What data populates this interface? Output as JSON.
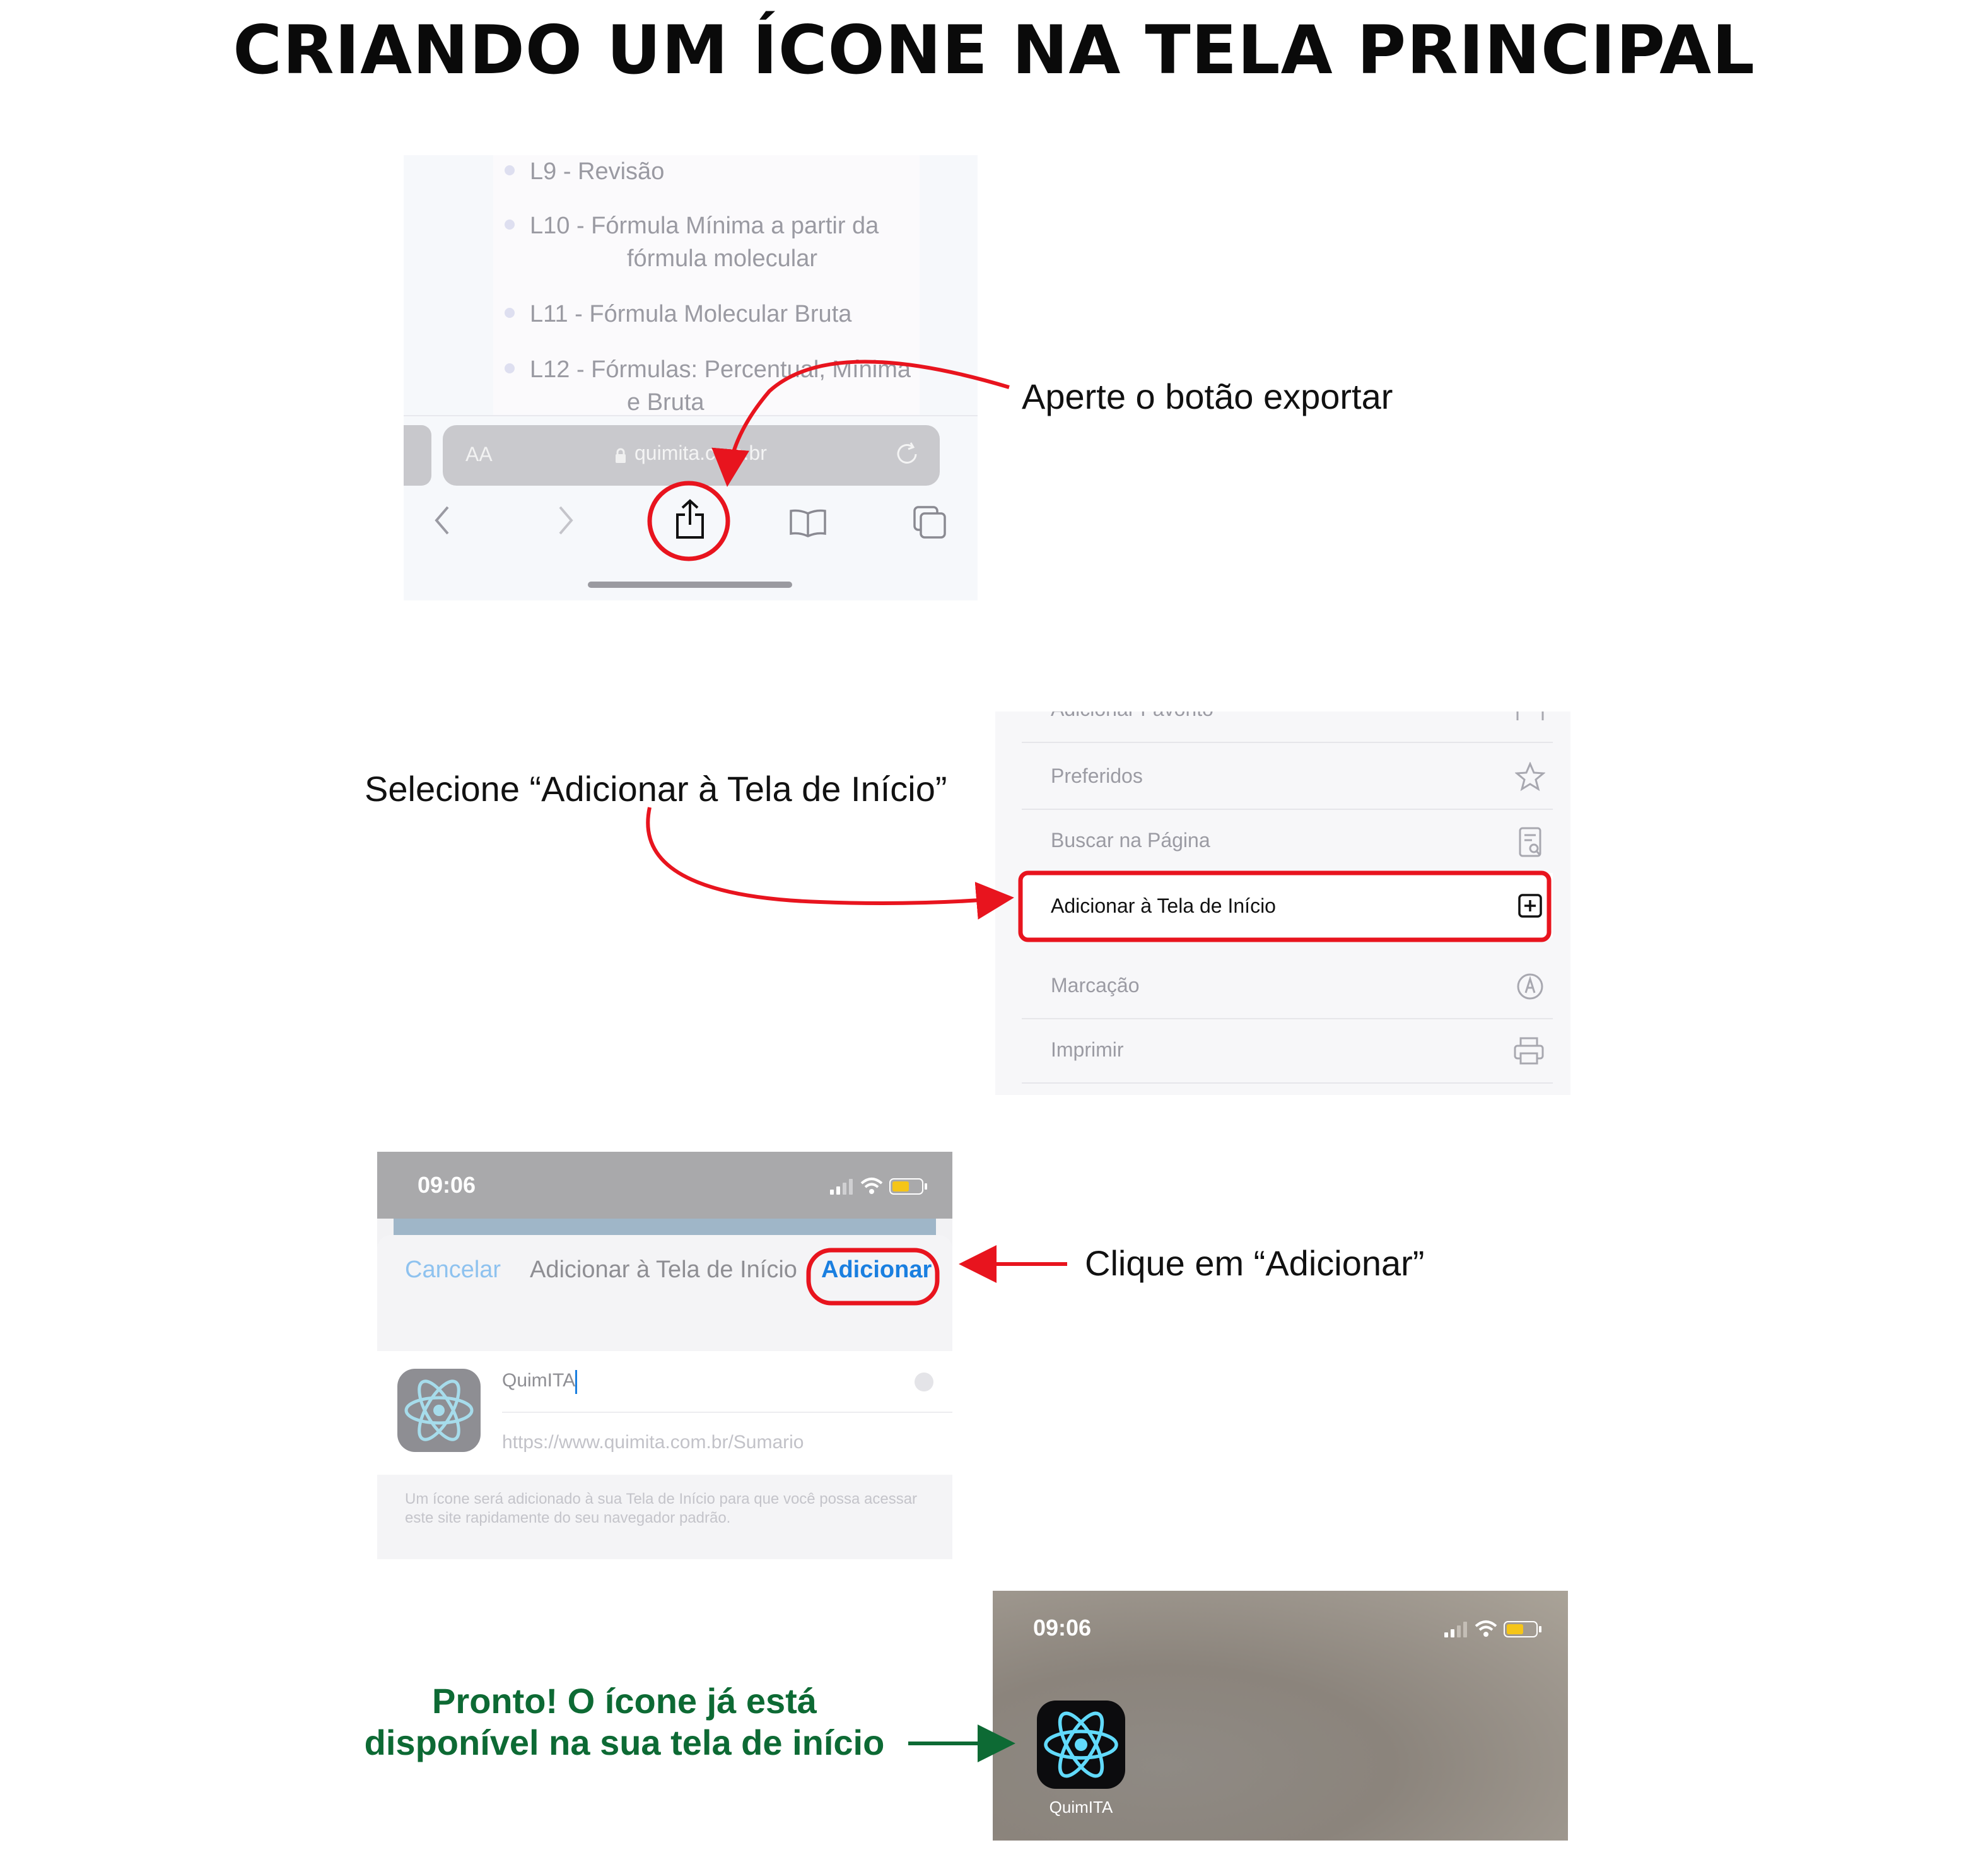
{
  "title": "CRIANDO UM ÍCONE NA TELA PRINCIPAL",
  "steps": {
    "step1": "Aperte o botão exportar",
    "step2": "Selecione “Adicionar à Tela de Início”",
    "step3": "Clique em “Adicionar”",
    "step4_line1": "Pronto! O ícone já está",
    "step4_line2": "disponível na sua tela de início"
  },
  "safari": {
    "items": [
      {
        "line1": "L9 - Revisão",
        "line2": ""
      },
      {
        "line1": "L10 - Fórmula Mínima a partir da",
        "line2": "fórmula molecular"
      },
      {
        "line1": "L11 - Fórmula Molecular Bruta",
        "line2": ""
      },
      {
        "line1": "L12 - Fórmulas: Percentual, Mínima",
        "line2": "e Bruta"
      }
    ],
    "aa": "AA",
    "host": "quimita.com.br",
    "icons": [
      "back-icon",
      "forward-icon",
      "share-icon",
      "bookmarks-icon",
      "tabs-icon"
    ]
  },
  "share_menu": {
    "partial": "Adicionar Favorito",
    "items": [
      {
        "label": "Preferidos",
        "icon": "star-icon"
      },
      {
        "label": "Buscar na Página",
        "icon": "find-icon"
      },
      {
        "label": "Adicionar à Tela de Início",
        "icon": "plus-square-icon"
      },
      {
        "label": "Marcação",
        "icon": "markup-icon"
      },
      {
        "label": "Imprimir",
        "icon": "print-icon"
      }
    ]
  },
  "dialog": {
    "time": "09:06",
    "cancel": "Cancelar",
    "title": "Adicionar à Tela de Início",
    "add": "Adicionar",
    "name_value": "QuimITA",
    "url": "https://www.quimita.com.br/Sumario",
    "help": "Um ícone será adicionado à sua Tela de Início para que você possa acessar este site rapidamente do seu navegador padrão."
  },
  "home": {
    "time": "09:06",
    "app_label": "QuimITA"
  },
  "colors": {
    "highlight_red": "#e8141e",
    "ios_blue": "#1a7fe0",
    "ios_blue_light": "#8ec2ef",
    "green": "#0d6a34",
    "react_cyan": "#61dafb",
    "battery_yellow": "#f5c518"
  }
}
